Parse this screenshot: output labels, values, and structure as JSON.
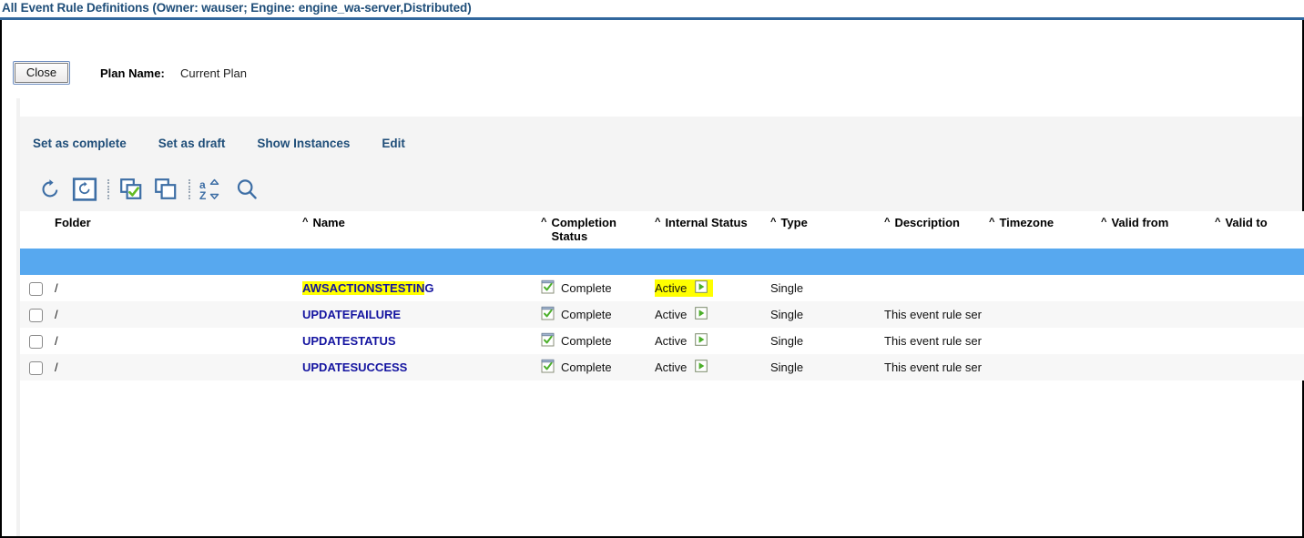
{
  "window": {
    "title": "All Event Rule Definitions (Owner: wauser; Engine: engine_wa-server,Distributed)"
  },
  "colors": {
    "title_blue": "#1f4e79",
    "rule_blue": "#31679d",
    "header_rule": "#57a8ef",
    "link_navy": "#1414a0",
    "highlight_yellow": "#ffff00",
    "toolbar_bg": "#f4f4f4",
    "row_stripe": "#f7f7f7",
    "icon_blue": "#3d6ea5",
    "status_green": "#4caf2a"
  },
  "topbar": {
    "close_label": "Close",
    "plan_label": "Plan Name:",
    "plan_value": "Current Plan"
  },
  "toolbar": {
    "commands": [
      {
        "label": "Set as complete",
        "name": "set-as-complete"
      },
      {
        "label": "Set as draft",
        "name": "set-as-draft"
      },
      {
        "label": "Show Instances",
        "name": "show-instances"
      },
      {
        "label": "Edit",
        "name": "edit"
      }
    ],
    "icons": [
      {
        "name": "refresh-icon",
        "title": "Refresh"
      },
      {
        "name": "auto-refresh-icon",
        "title": "Auto Refresh"
      },
      {
        "name": "select-all-icon",
        "title": "Select All"
      },
      {
        "name": "deselect-all-icon",
        "title": "Deselect All"
      },
      {
        "name": "sort-az-icon",
        "title": "Sort"
      },
      {
        "name": "search-icon",
        "title": "Search"
      }
    ]
  },
  "table": {
    "columns": [
      {
        "key": "folder",
        "label": "Folder",
        "sortable": false
      },
      {
        "key": "name",
        "label": "Name",
        "sortable": true
      },
      {
        "key": "completion",
        "label": "Completion Status",
        "sortable": true
      },
      {
        "key": "internal",
        "label": "Internal Status",
        "sortable": true
      },
      {
        "key": "type",
        "label": "Type",
        "sortable": true
      },
      {
        "key": "desc",
        "label": "Description",
        "sortable": true
      },
      {
        "key": "timezone",
        "label": "Timezone",
        "sortable": true
      },
      {
        "key": "validfrom",
        "label": "Valid from",
        "sortable": true
      },
      {
        "key": "validto",
        "label": "Valid to",
        "sortable": true
      }
    ],
    "sort_caret": "^",
    "rows": [
      {
        "checked": false,
        "folder": "/",
        "name": "AWSACTIONSTESTING",
        "name_highlight": "AWSACTIONSTESTIN",
        "name_tail": "G",
        "completion": "Complete",
        "internal": "Active",
        "internal_highlight": true,
        "type": "Single",
        "desc": "",
        "timezone": "",
        "validfrom": "",
        "validto": ""
      },
      {
        "checked": false,
        "folder": "/",
        "name": "UPDATEFAILURE",
        "name_highlight": "",
        "name_tail": "UPDATEFAILURE",
        "completion": "Complete",
        "internal": "Active",
        "internal_highlight": false,
        "type": "Single",
        "desc": "This event rule ser",
        "timezone": "",
        "validfrom": "",
        "validto": ""
      },
      {
        "checked": false,
        "folder": "/",
        "name": "UPDATESTATUS",
        "name_highlight": "",
        "name_tail": "UPDATESTATUS",
        "completion": "Complete",
        "internal": "Active",
        "internal_highlight": false,
        "type": "Single",
        "desc": "This event rule ser",
        "timezone": "",
        "validfrom": "",
        "validto": ""
      },
      {
        "checked": false,
        "folder": "/",
        "name": "UPDATESUCCESS",
        "name_highlight": "",
        "name_tail": "UPDATESUCCESS",
        "completion": "Complete",
        "internal": "Active",
        "internal_highlight": false,
        "type": "Single",
        "desc": "This event rule ser",
        "timezone": "",
        "validfrom": "",
        "validto": ""
      }
    ]
  }
}
